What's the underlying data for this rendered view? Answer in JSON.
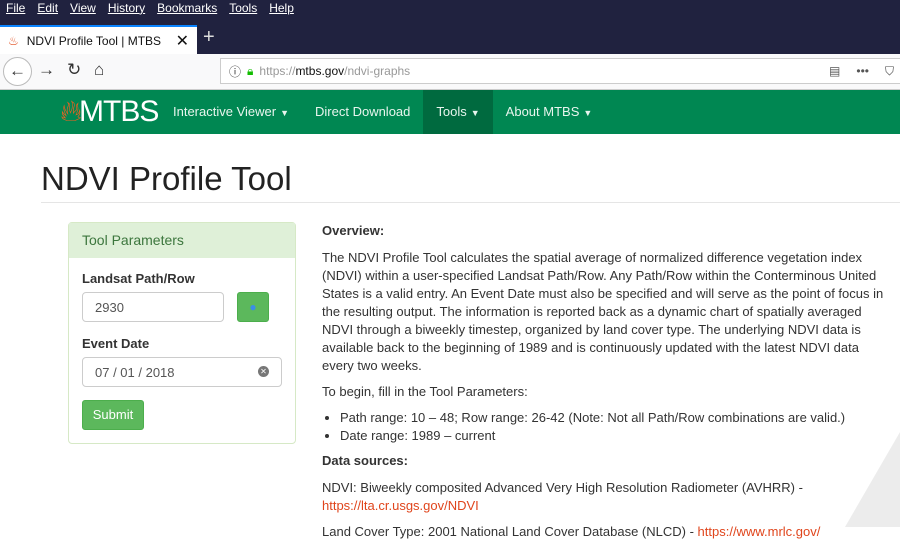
{
  "browser": {
    "menu": [
      "File",
      "Edit",
      "View",
      "History",
      "Bookmarks",
      "Tools",
      "Help"
    ],
    "tab_title": "NDVI Profile Tool | MTBS",
    "url_prefix": "https://",
    "url_domain": "mtbs.gov",
    "url_path": "/ndvi-graphs"
  },
  "site": {
    "logo": "MTBS",
    "nav": [
      "Interactive Viewer",
      "Direct Download",
      "Tools",
      "About MTBS"
    ]
  },
  "page_title": "NDVI Profile Tool",
  "panel": {
    "title": "Tool Parameters",
    "path_label": "Landsat Path/Row",
    "path_value": "2930",
    "date_label": "Event Date",
    "date_value": "07 / 01 / 2018",
    "submit": "Submit"
  },
  "overview": {
    "heading": "Overview:",
    "p1": "The NDVI Profile Tool calculates the spatial average of normalized difference vegetation index (NDVI) within a user-specified Landsat Path/Row. Any Path/Row within the Conterminous United States is a valid entry. An Event Date must also be specified and will serve as the point of focus in the resulting output. The information is reported back as a dynamic chart of spatially averaged NDVI through a biweekly timestep, organized by land cover type. The underlying NDVI data is available back to the beginning of 1989 and is continuously updated with the latest NDVI data every two weeks.",
    "p2": "To begin, fill in the Tool Parameters:",
    "bullets": [
      "Path range: 10 – 48; Row range: 26-42 (Note: Not all Path/Row combinations are valid.)",
      "Date range: 1989 – current"
    ],
    "sources_heading": "Data sources:",
    "ndvi_text": "NDVI: Biweekly composited Advanced Very High Resolution Radiometer (AVHRR) -",
    "ndvi_link": "https://lta.cr.usgs.gov/NDVI",
    "lc_text": "Land Cover Type: 2001 National Land Cover Database (NLCD) - ",
    "lc_link": "https://www.mrlc.gov/"
  }
}
